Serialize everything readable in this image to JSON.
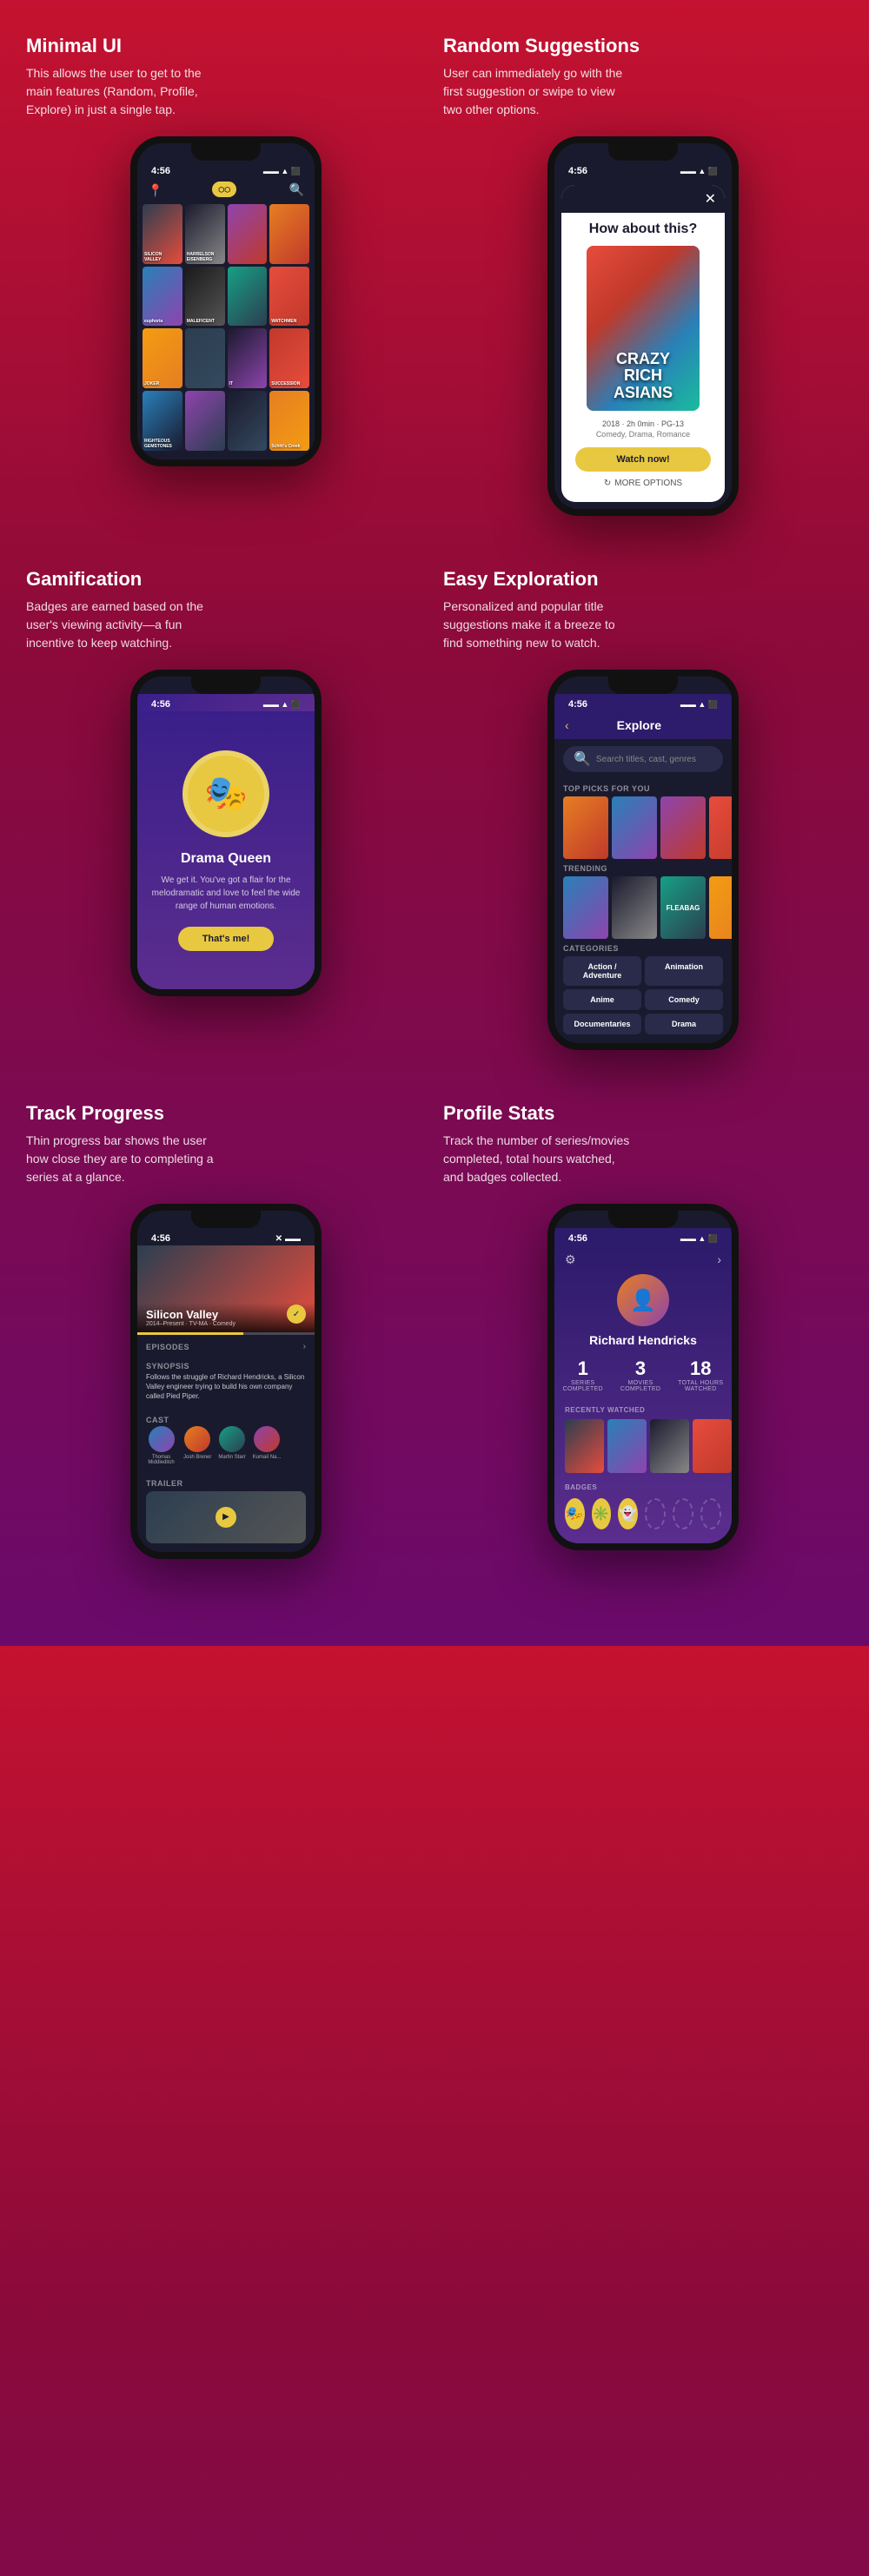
{
  "sections": [
    {
      "id": "minimal-ui",
      "title": "Minimal UI",
      "description": "This allows the user to get to the main features (Random, Profile, Explore) in just a single tap.",
      "position": "left"
    },
    {
      "id": "random-suggestions",
      "title": "Random Suggestions",
      "description": "User can immediately go with the first suggestion or swipe to view two other options.",
      "position": "right"
    },
    {
      "id": "gamification",
      "title": "Gamification",
      "description": "Badges are earned based on the user's viewing activity—a fun incentive to keep watching.",
      "position": "left"
    },
    {
      "id": "easy-exploration",
      "title": "Easy Exploration",
      "description": "Personalized and popular title suggestions make it a breeze to find something new to watch.",
      "position": "right"
    },
    {
      "id": "track-progress",
      "title": "Track Progress",
      "description": "Thin progress bar shows the user how close they are to completing a series at a glance.",
      "position": "left"
    },
    {
      "id": "profile-stats",
      "title": "Profile Stats",
      "description": "Track the number of series/movies completed, total hours watched, and badges collected.",
      "position": "right"
    }
  ],
  "phone": {
    "status_time": "4:56"
  },
  "screen_suggestion": {
    "how_about": "How about this?",
    "movie_title": "CRAZY RICH\nASIANS",
    "movie_year_info": "2018 · 2h 0min · PG-13",
    "movie_genres": "Comedy, Drama, Romance",
    "watch_btn": "Watch now!",
    "more_options": "MORE OPTIONS"
  },
  "screen_gamification": {
    "badge_title": "Drama Queen",
    "badge_desc": "We get it. You've got a flair for the melodramatic and love to feel the wide range of human emotions.",
    "button_label": "That's me!",
    "badge_icon": "🎭"
  },
  "screen_explore": {
    "title": "Explore",
    "search_placeholder": "Search titles, cast, genres",
    "top_picks_label": "TOP PICKS FOR YOU",
    "trending_label": "TRENDING",
    "categories_label": "CATEGORIES",
    "categories": [
      "Action / Adventure",
      "Animation",
      "Anime",
      "Comedy",
      "Documentaries",
      "Drama"
    ]
  },
  "screen_track": {
    "show_title": "Silicon Valley",
    "show_meta": "2014–Present  ·  TV-MA  ·  Comedy",
    "episodes_label": "EPISODES",
    "synopsis_label": "SYNOPSIS",
    "synopsis_text": "Follows the struggle of Richard Hendricks, a Silicon Valley engineer trying to build his own company called Pied Piper.",
    "cast_label": "CAST",
    "trailer_label": "TRAILER",
    "cast": [
      {
        "name": "Thomas Middleditch"
      },
      {
        "name": "Josh Brener"
      },
      {
        "name": "Martin Starr"
      },
      {
        "name": "Kumail Na..."
      }
    ]
  },
  "screen_profile": {
    "name": "Richard Hendricks",
    "stats": [
      {
        "number": "1",
        "label": "SERIES\nCOMPLETED"
      },
      {
        "number": "3",
        "label": "MOVIES\nCOMPLETED"
      },
      {
        "number": "18",
        "label": "TOTAL HOURS\nWATCHED"
      }
    ],
    "recently_watched_label": "RECENTLY WATCHED",
    "badges_label": "BADGES",
    "badges": [
      "🎭",
      "✳️",
      "👻"
    ]
  }
}
